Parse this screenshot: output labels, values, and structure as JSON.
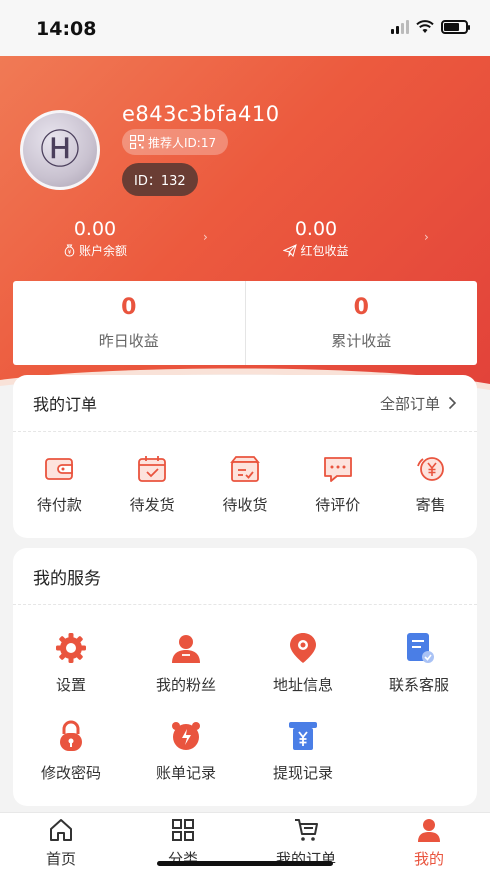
{
  "status": {
    "time": "14:08"
  },
  "profile": {
    "username": "e843c3bfa410",
    "referrer": "推荐人ID:17",
    "id_label": "ID：132"
  },
  "stats": {
    "balance": {
      "value": "0.00",
      "label": "账户余额"
    },
    "red_packet": {
      "value": "0.00",
      "label": "红包收益"
    }
  },
  "earnings": {
    "yesterday": {
      "value": "0",
      "label": "昨日收益"
    },
    "total": {
      "value": "0",
      "label": "累计收益"
    }
  },
  "orders": {
    "title": "我的订单",
    "all_label": "全部订单",
    "items": [
      {
        "label": "待付款",
        "icon": "wallet-icon"
      },
      {
        "label": "待发货",
        "icon": "calendar-icon"
      },
      {
        "label": "待收货",
        "icon": "box-icon"
      },
      {
        "label": "待评价",
        "icon": "comment-icon"
      },
      {
        "label": "寄售",
        "icon": "yen-refresh-icon"
      }
    ]
  },
  "services": {
    "title": "我的服务",
    "items": [
      {
        "label": "设置",
        "icon": "gear-icon"
      },
      {
        "label": "我的粉丝",
        "icon": "user-icon"
      },
      {
        "label": "地址信息",
        "icon": "location-pin-icon"
      },
      {
        "label": "联系客服",
        "icon": "document-icon"
      },
      {
        "label": "修改密码",
        "icon": "lock-icon"
      },
      {
        "label": "账单记录",
        "icon": "alarm-clock-icon"
      },
      {
        "label": "提现记录",
        "icon": "withdraw-icon"
      }
    ]
  },
  "tabbar": {
    "items": [
      {
        "label": "首页",
        "icon": "home-icon"
      },
      {
        "label": "分类",
        "icon": "grid-icon"
      },
      {
        "label": "我的订单",
        "icon": "cart-icon"
      },
      {
        "label": "我的",
        "icon": "person-icon"
      }
    ],
    "active_index": 3
  },
  "colors": {
    "accent": "#e9543e",
    "header_start": "#f07a55",
    "header_end": "#e2423a",
    "id_pill": "#6a3d34"
  }
}
